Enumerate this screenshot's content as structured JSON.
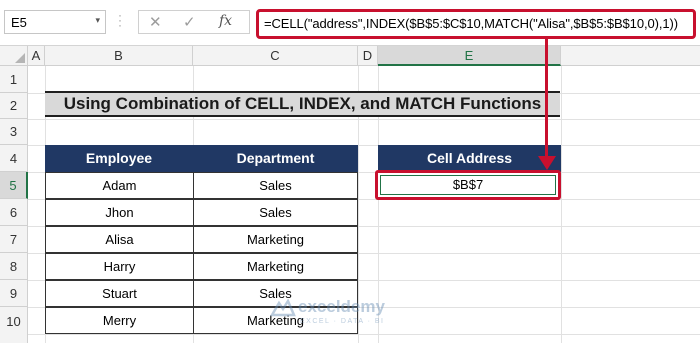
{
  "formula_bar": {
    "name_box": "E5",
    "name_box_arrow": "▾",
    "cancel_icon": "✕",
    "enter_icon": "✓",
    "fx_label": "fx",
    "formula": "=CELL(\"address\",INDEX($B$5:$C$10,MATCH(\"Alisa\",$B$5:$B$10,0),1))"
  },
  "columns": [
    "A",
    "B",
    "C",
    "D",
    "E"
  ],
  "rows": [
    "1",
    "2",
    "3",
    "4",
    "5",
    "6",
    "7",
    "8",
    "9",
    "10"
  ],
  "title": "Using Combination of CELL, INDEX, and MATCH Functions",
  "table": {
    "headers": [
      "Employee",
      "Department"
    ],
    "rows": [
      [
        "Adam",
        "Sales"
      ],
      [
        "Jhon",
        "Sales"
      ],
      [
        "Alisa",
        "Marketing"
      ],
      [
        "Harry",
        "Marketing"
      ],
      [
        "Stuart",
        "Sales"
      ],
      [
        "Merry",
        "Marketing"
      ]
    ]
  },
  "result": {
    "header": "Cell Address",
    "value": "$B$7"
  },
  "watermark": {
    "name": "exceldemy",
    "tagline": "EXCEL · DATA · BI"
  },
  "colors": {
    "header_fill": "#203864",
    "highlight": "#c8102e",
    "title_fill": "#d9d9d9",
    "excel_green": "#217346"
  }
}
